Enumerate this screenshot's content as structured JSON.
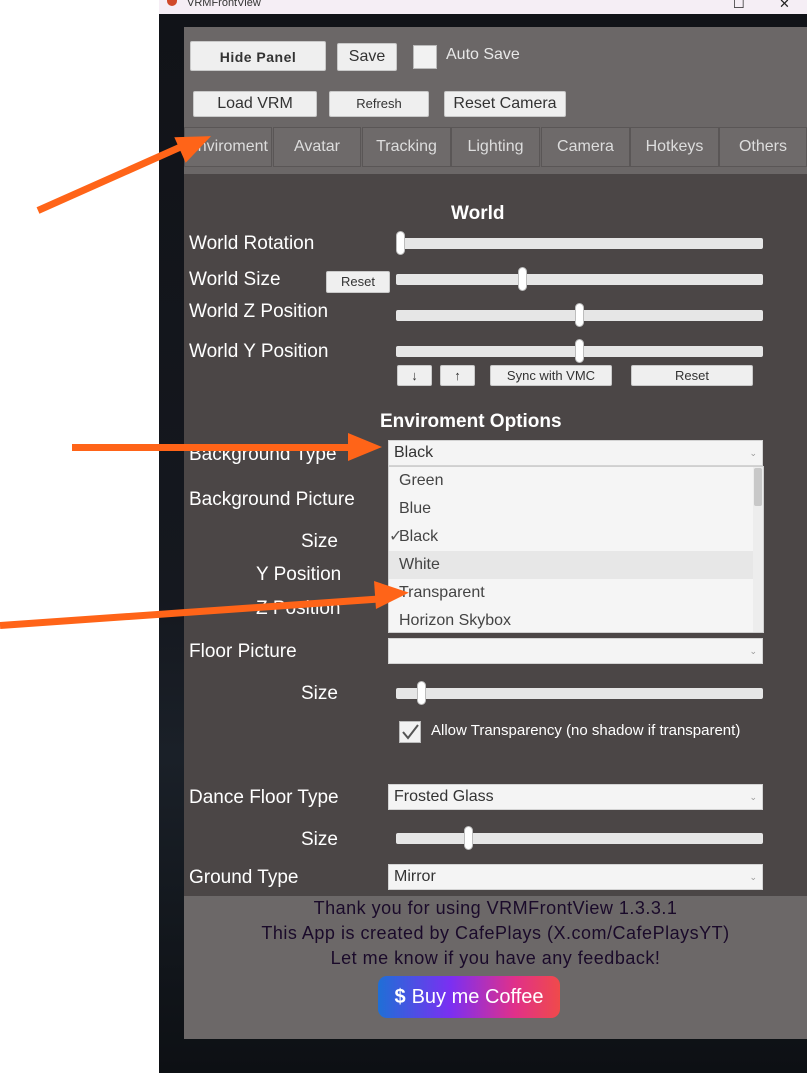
{
  "window": {
    "title": "VRMFrontView",
    "minimize": "—",
    "maximize": "☐",
    "close": "✕"
  },
  "toolbar": {
    "hide_panel": "Hide Panel",
    "save": "Save",
    "auto_save": "Auto Save",
    "load_vrm": "Load VRM",
    "refresh": "Refresh",
    "reset_camera": "Reset Camera"
  },
  "tabs": [
    "Enviroment",
    "Avatar",
    "Tracking",
    "Lighting",
    "Camera",
    "Hotkeys",
    "Others"
  ],
  "world": {
    "header": "World",
    "rotation_label": "World Rotation",
    "rotation_value": 0.0,
    "size_label": "World Size",
    "size_reset": "Reset",
    "size_value": 0.34,
    "z_label": "World Z Position",
    "z_value": 0.5,
    "y_label": "World Y Position",
    "y_value": 0.5,
    "down_btn": "↓",
    "up_btn": "↑",
    "sync_vmc": "Sync with VMC",
    "reset": "Reset"
  },
  "env": {
    "header": "Enviroment Options",
    "bg_type_label": "Background Type",
    "bg_type_value": "Black",
    "bg_picture_label": "Background Picture",
    "size_label": "Size",
    "y_pos_label": "Y Position",
    "z_pos_label": "Z Position",
    "dropdown_options": [
      "Green",
      "Blue",
      "Black",
      "White",
      "Transparent",
      "Horizon Skybox"
    ],
    "dropdown_selected": "Black",
    "dropdown_hovered": "White",
    "checkmark": "✓",
    "floor_picture_label": "Floor Picture",
    "floor_picture_value": "",
    "floor_size_label": "Size",
    "floor_size_value": 0.06,
    "allow_transparency": "Allow Transparency (no shadow if transparent)",
    "allow_transparency_checked": true,
    "dance_floor_label": "Dance Floor Type",
    "dance_floor_value": "Frosted Glass",
    "dance_size_label": "Size",
    "dance_size_value": 0.19,
    "ground_label": "Ground Type",
    "ground_value": "Mirror"
  },
  "footer": {
    "line1": "Thank you for using VRMFrontView 1.3.3.1",
    "line2": "This App is created by CafePlays (X.com/CafePlaysYT)",
    "line3": "Let me know if you have any feedback!",
    "coffee_icon": "$",
    "coffee": "Buy me Coffee"
  },
  "colors": {
    "arrow": "#ff6418",
    "panel": "#6b6767",
    "settings": "#4b4646"
  }
}
